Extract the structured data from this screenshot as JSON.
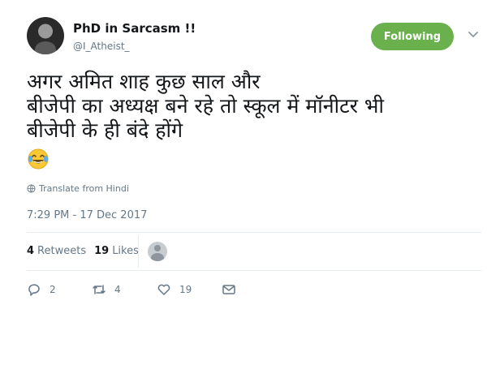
{
  "tweet": {
    "author": {
      "name": "PhD in Sarcasm !!",
      "handle": "@I_Atheist_"
    },
    "follow_label": "Following",
    "text": "अगर अमित शाह कुछ साल और\nबीजेपी का अध्यक्ष बने रहे तो स्कूल में मॉनीटर भी\nबीजेपी के ही बंदे होंगे",
    "emoji": "face-with-tears-of-joy",
    "translate_label": "Translate from Hindi",
    "timestamp": "7:29 PM - 17 Dec 2017",
    "stats": {
      "retweets_count": "4",
      "retweets_label": "Retweets",
      "likes_count": "19",
      "likes_label": "Likes"
    },
    "actions": {
      "reply_count": "2",
      "retweet_count": "4",
      "like_count": "19"
    }
  },
  "colors": {
    "follow_button": "#6ab04c",
    "secondary_text": "#657786",
    "primary_text": "#14171a"
  }
}
